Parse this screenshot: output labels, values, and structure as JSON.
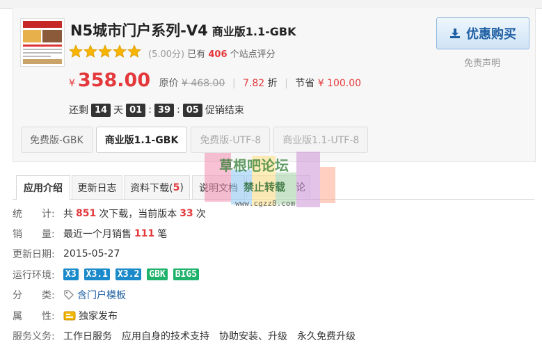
{
  "product": {
    "title": "N5城市门户系列-V4",
    "edition": "商业版1.1-GBK",
    "rating_score": "(5.00分)",
    "rating_prefix": "已有",
    "rating_count": "406",
    "rating_suffix": "个站点评分",
    "rating_stars": 5
  },
  "buy": {
    "label": "优惠购买",
    "disclaimer": "免责声明"
  },
  "price": {
    "currency": "¥",
    "current": "358.00",
    "orig_label": "原价",
    "orig_value": "¥ 468.00",
    "discount_value": "7.82",
    "discount_unit": "折",
    "save_label": "节省",
    "save_value": "¥ 100.00"
  },
  "countdown": {
    "prefix": "还剩",
    "days": "14",
    "day_unit": "天",
    "hours": "01",
    "minutes": "39",
    "seconds": "05",
    "colon": ":",
    "suffix": "促销结束"
  },
  "editions": [
    {
      "label": "免费版-GBK"
    },
    {
      "label": "商业版1.1-GBK"
    },
    {
      "label": "免费版-UTF-8"
    },
    {
      "label": "商业版1.1-UTF-8"
    }
  ],
  "tabs": [
    {
      "label": "应用介绍"
    },
    {
      "label": "更新日志"
    },
    {
      "label": "资料下载(",
      "count": "5",
      "close": ")"
    },
    {
      "label": "说明文档"
    },
    {
      "label": "论"
    }
  ],
  "info": {
    "stats": {
      "key": "统　　计:",
      "t1": "共",
      "downloads": "851",
      "t2": "次下载，当前版本",
      "version_downloads": "33",
      "t3": "次"
    },
    "sales": {
      "key": "销　　量:",
      "t1": "最近一个月销售",
      "count": "111",
      "t2": "笔"
    },
    "updated": {
      "key": "更新日期:",
      "value": "2015-05-27"
    },
    "env": {
      "key": "运行环境:",
      "tags": [
        {
          "label": "X3",
          "color": "#1a8acb"
        },
        {
          "label": "X3.1",
          "color": "#1a8acb"
        },
        {
          "label": "X3.2",
          "color": "#1a8acb"
        },
        {
          "label": "GBK",
          "color": "#1fb26b"
        },
        {
          "label": "BIG5",
          "color": "#1fb26b"
        }
      ]
    },
    "category": {
      "key": "分　　类:",
      "value": "含门户模板"
    },
    "attribute": {
      "key": "属　　性:",
      "value": "独家发布"
    },
    "service": {
      "key": "服务义务:",
      "items": [
        "工作日服务",
        "应用自身的技术支持",
        "协助安装、升级",
        "永久免费升级"
      ]
    }
  },
  "watermark": {
    "line1": "草根吧论坛",
    "line2": "禁止转载",
    "url": "www.cgzz8.com"
  },
  "colors": {
    "accent_red": "#e4393c",
    "link_blue": "#1e5fa3"
  }
}
